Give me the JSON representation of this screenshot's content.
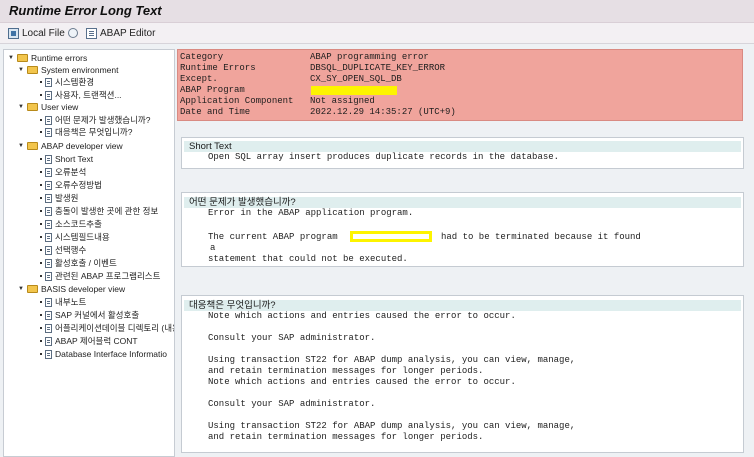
{
  "window": {
    "title": "Runtime Error Long Text"
  },
  "toolbar": {
    "local_file": "Local File",
    "abap_editor": "ABAP Editor"
  },
  "tree": {
    "runtime_errors": "Runtime errors",
    "system_environment": "System environment",
    "sys_env_items": [
      "시스템환경",
      "사용자, 트랜잭션..."
    ],
    "user_view": "User view",
    "user_view_items": [
      "어떤 문제가 발생했습니까?",
      "대응책은 무엇입니까?"
    ],
    "abap_dev_view": "ABAP developer view",
    "abap_dev_items": [
      "Short Text",
      "오류분석",
      "오류수정방법",
      "발생원",
      "충돌이 발생한 곳에 관한 정보",
      "소스코드추출",
      "시스템필드내용",
      "선택행수",
      "활성호출 / 이벤트",
      "관련된 ABAP 프로그램리스트"
    ],
    "basis_dev_view": "BASIS developer view",
    "basis_dev_items": [
      "내부노트",
      "SAP 커널에서 활성호출",
      "어플리케이션데이블 디렉토리 (내용",
      "ABAP 제어블럭 CONT",
      "Database Interface Informatio"
    ]
  },
  "header": {
    "rows": [
      {
        "key": "Category",
        "value": "ABAP programming error"
      },
      {
        "key": "Runtime Errors",
        "value": "DBSQL_DUPLICATE_KEY_ERROR"
      },
      {
        "key": "Except.",
        "value": "CX_SY_OPEN_SQL_DB"
      },
      {
        "key": "ABAP Program",
        "value": ""
      },
      {
        "key": "Application Component",
        "value": "Not assigned"
      },
      {
        "key": "Date and Time",
        "value": "2022.12.29 14:35:27 (UTC+9)"
      }
    ],
    "highlight_color": "#fdf400"
  },
  "short_text": {
    "title": "Short Text",
    "line1": "Open SQL array insert produces duplicate records in the database."
  },
  "what_happened": {
    "title": "어떤 문제가 발생했습니까?",
    "line1": "Error in the ABAP application program.",
    "line2a": "The current ABAP program",
    "line2b": "had to be terminated because it found",
    "line3": "a",
    "line4": "statement that could not be executed."
  },
  "what_can_you_do": {
    "title": "대응책은 무엇입니까?",
    "lines": [
      "Note which actions and entries caused the error to occur.",
      "",
      "Consult your SAP administrator.",
      "",
      "Using transaction ST22 for ABAP dump analysis, you can view, manage,",
      "and retain termination messages for longer periods.",
      "Note which actions and entries caused the error to occur.",
      "",
      "Consult your SAP administrator.",
      "",
      "Using transaction ST22 for ABAP dump analysis, you can view, manage,",
      "and retain termination messages for longer periods."
    ]
  }
}
